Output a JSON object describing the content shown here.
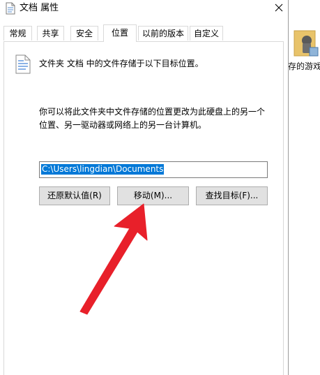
{
  "window": {
    "title": "文档 属性",
    "close_symbol": "✕"
  },
  "tabs": [
    {
      "label": "常规"
    },
    {
      "label": "共享"
    },
    {
      "label": "安全"
    },
    {
      "label": "位置",
      "active": true
    },
    {
      "label": "以前的版本"
    },
    {
      "label": "自定义"
    }
  ],
  "location": {
    "info_text": "文件夹 文档 中的文件存储于以下目标位置。",
    "description_line1": "你可以将此文件夹中文件存储的位置更改为此硬盘上的另一个",
    "description_line2": "位置、另一驱动器或网络上的另一台计算机。",
    "path_value": "C:\\Users\\lingdian\\Documents"
  },
  "buttons": {
    "restore_default": "还原默认值(R)",
    "move": "移动(M)...",
    "find_target": "查找目标(F)..."
  },
  "background": {
    "desktop_label": "存的游戏"
  },
  "colors": {
    "selection": "#0078d7",
    "arrow": "#e8202a",
    "button_bg": "#e1e1e1"
  },
  "icons": {
    "title": "document-icon",
    "close": "close-icon",
    "folder": "document-icon",
    "desktop": "saved-games-icon",
    "annotation": "red-arrow-annotation"
  }
}
